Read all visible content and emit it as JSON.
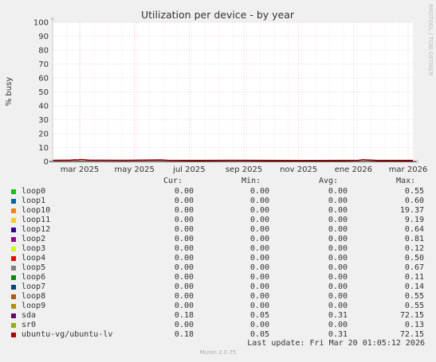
{
  "chart_data": {
    "type": "area",
    "title": "Utilization per device - by year",
    "ylabel": "% busy",
    "xlabel": "",
    "ylim": [
      0,
      100
    ],
    "yticks": [
      0,
      10,
      20,
      30,
      40,
      50,
      60,
      70,
      80,
      90,
      100
    ],
    "xticks": [
      "mar 2025",
      "may 2025",
      "jul 2025",
      "sep 2025",
      "nov 2025",
      "ene 2026",
      "mar 2026"
    ],
    "grid": true,
    "watermark": "RRDTOOL / TOBI OETIKER",
    "series": [
      {
        "name": "ubuntu-vg/ubuntu-lv",
        "color": "#a00000",
        "x": [
          0,
          0.05,
          0.06,
          0.07,
          0.08,
          0.09,
          0.1,
          0.2,
          0.3,
          0.32,
          0.4,
          0.5,
          0.6,
          0.7,
          0.8,
          0.85,
          0.86,
          0.9,
          1
        ],
        "values": [
          0.3,
          0.4,
          0.6,
          0.5,
          0.8,
          0.6,
          0.4,
          0.3,
          0.5,
          0.3,
          0.2,
          0.3,
          0.2,
          0.1,
          0.2,
          0.3,
          0.7,
          0.2,
          0.2
        ]
      }
    ]
  },
  "legend": {
    "headers": {
      "cur": "Cur:",
      "min": "Min:",
      "avg": "Avg:",
      "max": "Max:"
    },
    "rows": [
      {
        "name": "loop0",
        "color": "#00cc00",
        "cur": "0.00",
        "min": "0.00",
        "avg": "0.00",
        "max": "0.55"
      },
      {
        "name": "loop1",
        "color": "#0066b3",
        "cur": "0.00",
        "min": "0.00",
        "avg": "0.00",
        "max": "0.60"
      },
      {
        "name": "loop10",
        "color": "#ff8000",
        "cur": "0.00",
        "min": "0.00",
        "avg": "0.00",
        "max": "19.37"
      },
      {
        "name": "loop11",
        "color": "#ffcc00",
        "cur": "0.00",
        "min": "0.00",
        "avg": "0.00",
        "max": "9.19"
      },
      {
        "name": "loop12",
        "color": "#330099",
        "cur": "0.00",
        "min": "0.00",
        "avg": "0.00",
        "max": "0.64"
      },
      {
        "name": "loop2",
        "color": "#990099",
        "cur": "0.00",
        "min": "0.00",
        "avg": "0.00",
        "max": "0.81"
      },
      {
        "name": "loop3",
        "color": "#ccff00",
        "cur": "0.00",
        "min": "0.00",
        "avg": "0.00",
        "max": "0.12"
      },
      {
        "name": "loop4",
        "color": "#ff0000",
        "cur": "0.00",
        "min": "0.00",
        "avg": "0.00",
        "max": "0.50"
      },
      {
        "name": "loop5",
        "color": "#808080",
        "cur": "0.00",
        "min": "0.00",
        "avg": "0.00",
        "max": "0.67"
      },
      {
        "name": "loop6",
        "color": "#008f00",
        "cur": "0.00",
        "min": "0.00",
        "avg": "0.00",
        "max": "0.11"
      },
      {
        "name": "loop7",
        "color": "#00487d",
        "cur": "0.00",
        "min": "0.00",
        "avg": "0.00",
        "max": "0.14"
      },
      {
        "name": "loop8",
        "color": "#b35a00",
        "cur": "0.00",
        "min": "0.00",
        "avg": "0.00",
        "max": "0.55"
      },
      {
        "name": "loop9",
        "color": "#b38f00",
        "cur": "0.00",
        "min": "0.00",
        "avg": "0.00",
        "max": "0.55"
      },
      {
        "name": "sda",
        "color": "#6b006b",
        "cur": "0.18",
        "min": "0.05",
        "avg": "0.31",
        "max": "72.15"
      },
      {
        "name": "sr0",
        "color": "#8fb300",
        "cur": "0.00",
        "min": "0.00",
        "avg": "0.00",
        "max": "0.13"
      },
      {
        "name": "ubuntu-vg/ubuntu-lv",
        "color": "#b30000",
        "cur": "0.18",
        "min": "0.05",
        "avg": "0.31",
        "max": "72.15"
      }
    ]
  },
  "last_update": "Last update: Fri Mar 20 01:05:12 2026",
  "footer": "Munin 2.0.75"
}
